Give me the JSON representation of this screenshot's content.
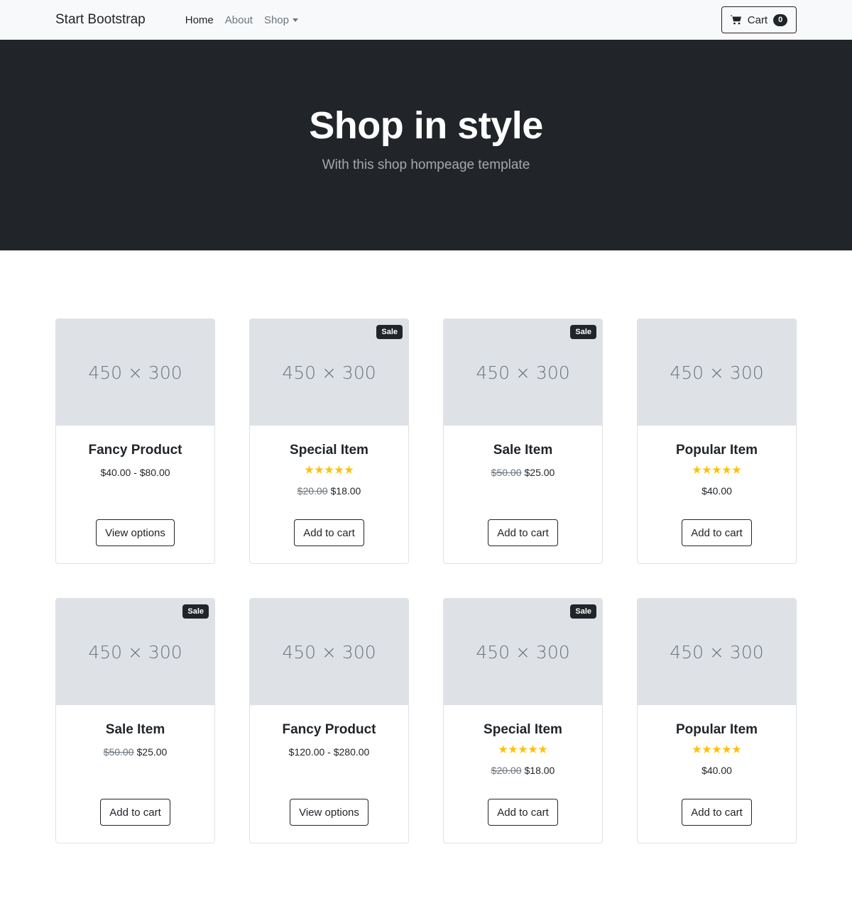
{
  "navbar": {
    "brand": "Start Bootstrap",
    "links": [
      {
        "label": "Home",
        "active": true
      },
      {
        "label": "About",
        "active": false
      },
      {
        "label": "Shop",
        "active": false,
        "dropdown": true
      }
    ],
    "cart_label": "Cart",
    "cart_count": "0"
  },
  "hero": {
    "title": "Shop in style",
    "subtitle": "With this shop hompeage template"
  },
  "products": [
    {
      "placeholder": "450 × 300",
      "name": "Fancy Product",
      "sale_badge": "",
      "rating": 0,
      "old_price": "",
      "price": "$40.00 - $80.00",
      "button": "View options"
    },
    {
      "placeholder": "450 × 300",
      "name": "Special Item",
      "sale_badge": "Sale",
      "rating": 5,
      "old_price": "$20.00",
      "price": "$18.00",
      "button": "Add to cart"
    },
    {
      "placeholder": "450 × 300",
      "name": "Sale Item",
      "sale_badge": "Sale",
      "rating": 0,
      "old_price": "$50.00",
      "price": "$25.00",
      "button": "Add to cart"
    },
    {
      "placeholder": "450 × 300",
      "name": "Popular Item",
      "sale_badge": "",
      "rating": 5,
      "old_price": "",
      "price": "$40.00",
      "button": "Add to cart"
    },
    {
      "placeholder": "450 × 300",
      "name": "Sale Item",
      "sale_badge": "Sale",
      "rating": 0,
      "old_price": "$50.00",
      "price": "$25.00",
      "button": "Add to cart"
    },
    {
      "placeholder": "450 × 300",
      "name": "Fancy Product",
      "sale_badge": "",
      "rating": 0,
      "old_price": "",
      "price": "$120.00 - $280.00",
      "button": "View options"
    },
    {
      "placeholder": "450 × 300",
      "name": "Special Item",
      "sale_badge": "Sale",
      "rating": 5,
      "old_price": "$20.00",
      "price": "$18.00",
      "button": "Add to cart"
    },
    {
      "placeholder": "450 × 300",
      "name": "Popular Item",
      "sale_badge": "",
      "rating": 5,
      "old_price": "",
      "price": "$40.00",
      "button": "Add to cart"
    }
  ],
  "colors": {
    "dark": "#212529",
    "light_bg": "#f8f9fa",
    "placeholder_bg": "#dee2e6",
    "star": "#ffc107",
    "muted": "#6c757d"
  },
  "icons": {
    "cart": "cart-icon",
    "star": "star-icon"
  }
}
